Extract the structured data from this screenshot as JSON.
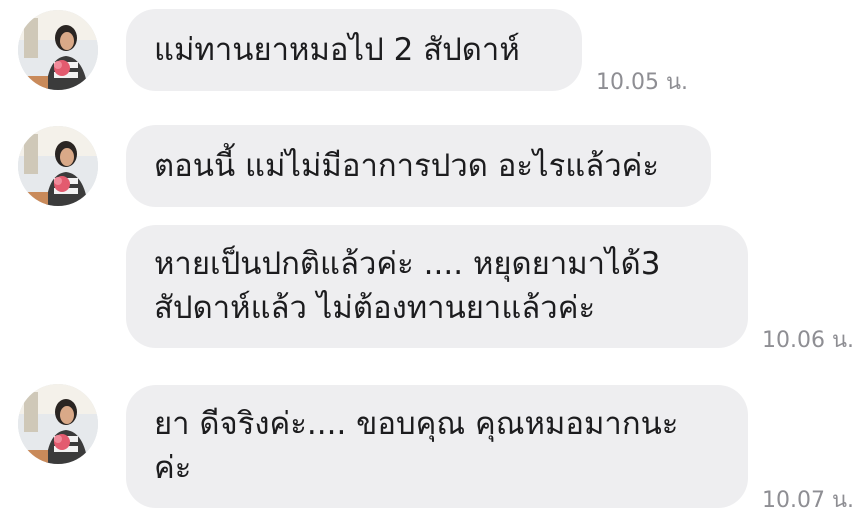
{
  "messages": [
    {
      "lines": [
        "แม่ทานยาหมอไป 2 สัปดาห์"
      ],
      "time": "10.05 น."
    },
    {
      "lines": [
        "ตอนนี้ แม่ไม่มีอาการปวด อะไรแล้วค่ะ"
      ],
      "time": ""
    },
    {
      "lines": [
        "หายเป็นปกติแล้วค่ะ .... หยุดยามาได้3",
        "สัปดาห์แล้ว ไม่ต้องทานยาแล้วค่ะ"
      ],
      "time": "10.06 น."
    },
    {
      "lines": [
        "ยา ดีจริงค่ะ.... ขอบคุณ คุณหมอมากนะ",
        "ค่ะ"
      ],
      "time": "10.07 น."
    }
  ],
  "avatar_icon": "user-avatar-icon",
  "colors": {
    "bubble": "#eeeef0",
    "text": "#1c1c1e",
    "timestamp": "#8e8e93",
    "background": "#ffffff"
  }
}
